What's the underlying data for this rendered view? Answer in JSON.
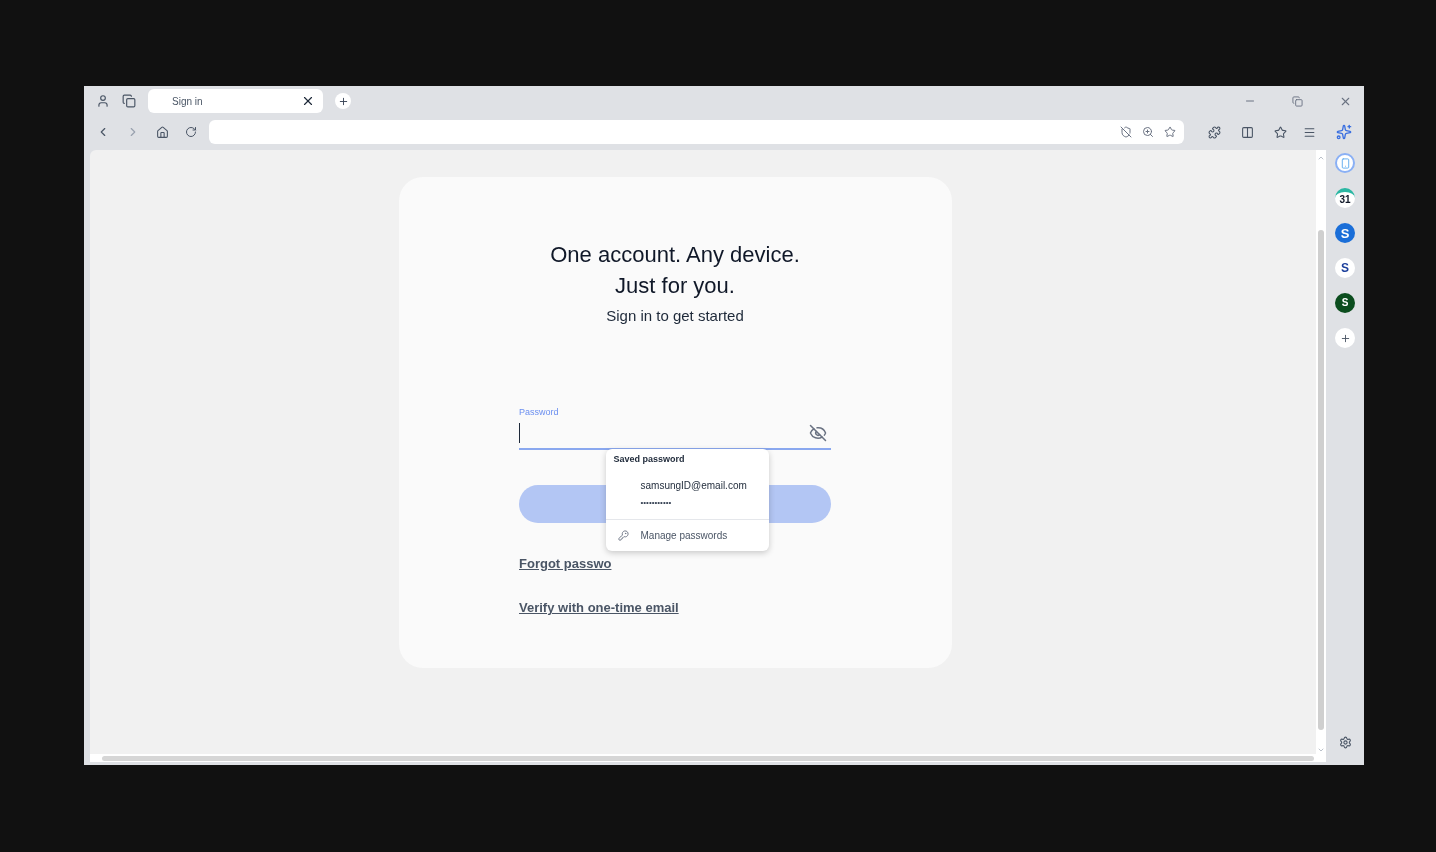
{
  "tabs": [
    {
      "label": "Sign in",
      "selected": true
    }
  ],
  "card": {
    "title_lines": [
      "One account. Any device.",
      "Just for you."
    ],
    "subtitle": "Sign in to get started",
    "password_field": {
      "label": "Password",
      "focused": true
    },
    "links": [
      "Forgot passwo",
      "Verify with one-time email"
    ]
  },
  "autofill_popup": {
    "heading": "Saved password",
    "account": "samsungID@email.com",
    "masked_password": "•••••••••••",
    "manage": "Manage passwords"
  },
  "sidebar_apps": [
    {
      "kind": "calendar",
      "label": "31"
    },
    {
      "kind": "blue",
      "label": "S"
    },
    {
      "kind": "white",
      "label": "S"
    },
    {
      "kind": "green",
      "label": "S"
    }
  ]
}
